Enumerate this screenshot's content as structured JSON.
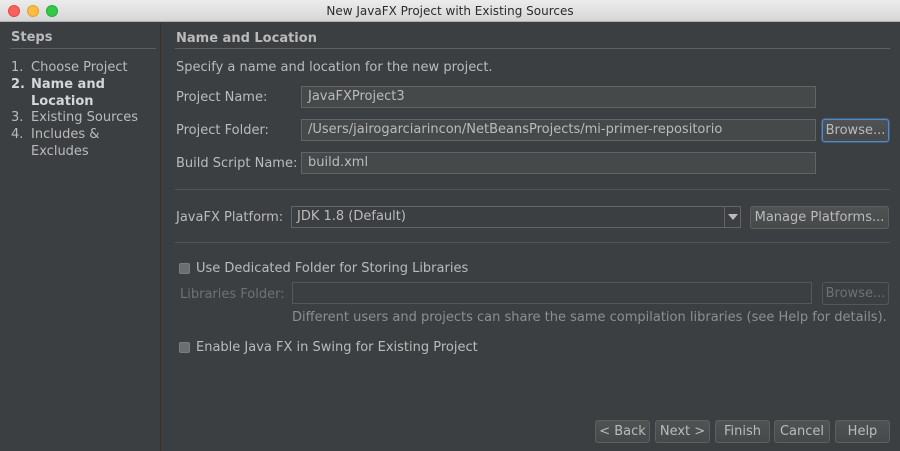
{
  "window": {
    "title": "New JavaFX Project with Existing Sources"
  },
  "steps": {
    "title": "Steps",
    "items": [
      {
        "num": "1.",
        "label": "Choose Project"
      },
      {
        "num": "2.",
        "label": "Name and Location"
      },
      {
        "num": "3.",
        "label": "Existing Sources"
      },
      {
        "num": "4.",
        "label": "Includes & Excludes"
      }
    ]
  },
  "main": {
    "title": "Name and Location",
    "intro": "Specify a name and location for the new project.",
    "project_name": {
      "label": "Project Name:",
      "value": "JavaFXProject3"
    },
    "project_folder": {
      "label": "Project Folder:",
      "value": "/Users/jairogarciarincon/NetBeansProjects/mi-primer-repositorio",
      "browse": "Browse..."
    },
    "build_script": {
      "label": "Build Script Name:",
      "value": "build.xml"
    },
    "platform": {
      "label": "JavaFX Platform:",
      "value": "JDK 1.8 (Default)",
      "manage": "Manage Platforms..."
    },
    "dedicated_folder": {
      "label": "Use Dedicated Folder for Storing Libraries",
      "checked": false
    },
    "libraries_folder": {
      "label": "Libraries Folder:",
      "value": "",
      "browse": "Browse..."
    },
    "libraries_hint": "Different users and projects can share the same compilation libraries (see Help for details).",
    "swing": {
      "label": "Enable Java FX in Swing for Existing Project",
      "checked": false
    }
  },
  "footer": {
    "back": "< Back",
    "next": "Next >",
    "finish": "Finish",
    "cancel": "Cancel",
    "help": "Help"
  }
}
